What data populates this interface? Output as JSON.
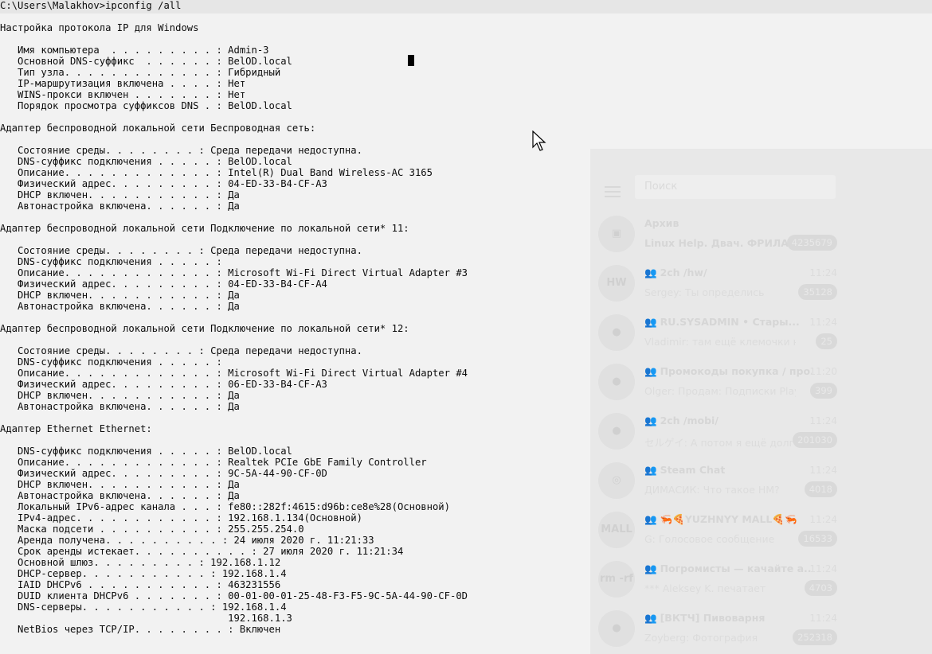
{
  "console": {
    "lines": [
      "C:\\Users\\Malakhov>ipconfig /all",
      "",
      "Настройка протокола IP для Windows",
      "",
      "   Имя компьютера  . . . . . . . . . : Admin-3",
      "   Основной DNS-суффикс  . . . . . . : BelOD.local",
      "   Тип узла. . . . . . . . . . . . . : Гибридный",
      "   IP-маршрутизация включена . . . . : Нет",
      "   WINS-прокси включен . . . . . . . : Нет",
      "   Порядок просмотра суффиксов DNS . : BelOD.local",
      "",
      "Адаптер беспроводной локальной сети Беспроводная сеть:",
      "",
      "   Состояние среды. . . . . . . . : Среда передачи недоступна.",
      "   DNS-суффикс подключения . . . . . : BelOD.local",
      "   Описание. . . . . . . . . . . . . : Intel(R) Dual Band Wireless-AC 3165",
      "   Физический адрес. . . . . . . . . : 04-ED-33-B4-CF-A3",
      "   DHCP включен. . . . . . . . . . . : Да",
      "   Автонастройка включена. . . . . . : Да",
      "",
      "Адаптер беспроводной локальной сети Подключение по локальной сети* 11:",
      "",
      "   Состояние среды. . . . . . . . : Среда передачи недоступна.",
      "   DNS-суффикс подключения . . . . . :",
      "   Описание. . . . . . . . . . . . . : Microsoft Wi-Fi Direct Virtual Adapter #3",
      "   Физический адрес. . . . . . . . . : 04-ED-33-B4-CF-A4",
      "   DHCP включен. . . . . . . . . . . : Да",
      "   Автонастройка включена. . . . . . : Да",
      "",
      "Адаптер беспроводной локальной сети Подключение по локальной сети* 12:",
      "",
      "   Состояние среды. . . . . . . . : Среда передачи недоступна.",
      "   DNS-суффикс подключения . . . . . :",
      "   Описание. . . . . . . . . . . . . : Microsoft Wi-Fi Direct Virtual Adapter #4",
      "   Физический адрес. . . . . . . . . : 06-ED-33-B4-CF-A3",
      "   DHCP включен. . . . . . . . . . . : Да",
      "   Автонастройка включена. . . . . . : Да",
      "",
      "Адаптер Ethernet Ethernet:",
      "",
      "   DNS-суффикс подключения . . . . . : BelOD.local",
      "   Описание. . . . . . . . . . . . . : Realtek PCIe GbE Family Controller",
      "   Физический адрес. . . . . . . . . : 9C-5A-44-90-CF-0D",
      "   DHCP включен. . . . . . . . . . . : Да",
      "   Автонастройка включена. . . . . . : Да",
      "   Локальный IPv6-адрес канала . . . : fe80::282f:4615:d96b:ce8e%28(Основной)",
      "   IPv4-адрес. . . . . . . . . . . . : 192.168.1.134(Основной)",
      "   Маска подсети . . . . . . . . . . : 255.255.254.0",
      "   Аренда получена. . . . . . . . . . : 24 июля 2020 г. 11:21:33",
      "   Срок аренды истекает. . . . . . . . . . : 27 июля 2020 г. 11:21:34",
      "   Основной шлюз. . . . . . . . . : 192.168.1.12",
      "   DHCP-сервер. . . . . . . . . . . : 192.168.1.4",
      "   IAID DHCPv6 . . . . . . . . . . . : 463231556",
      "   DUID клиента DHCPv6 . . . . . . . : 00-01-00-01-25-48-F3-F5-9C-5A-44-90-CF-0D",
      "   DNS-серверы. . . . . . . . . . . : 192.168.1.4",
      "                                       192.168.1.3",
      "   NetBios через TCP/IP. . . . . . . . : Включен"
    ]
  },
  "telegram": {
    "search_placeholder": "Поиск",
    "chats": [
      {
        "title": "Архив",
        "group": false,
        "time": "",
        "preview": "Linux Help. Двач. ФРИЛА...",
        "preview_bold": true,
        "badge": "4235679",
        "avatar": "▣"
      },
      {
        "title": "2ch /hw/",
        "group": true,
        "time": "11:24",
        "preview": "Sergey: Ты определись",
        "preview_bold": false,
        "badge": "35128",
        "avatar": "HW"
      },
      {
        "title": "RU.SYSADMIN • Стары...",
        "group": true,
        "time": "11:24",
        "preview": "Vladimir: там ещё клемочки нед...",
        "preview_bold": false,
        "badge": "25",
        "avatar": "●"
      },
      {
        "title": "Промокоды покупка / про...",
        "group": true,
        "time": "11:20",
        "preview": "Olger: Продам: Подписки PlaySta...",
        "preview_bold": false,
        "badge": "399",
        "avatar": "●"
      },
      {
        "title": "2ch /mobi/",
        "group": true,
        "time": "11:24",
        "preview": "セルゲイ: А потом я ещё долго...",
        "preview_bold": false,
        "badge": "201030",
        "avatar": "●"
      },
      {
        "title": "Steam Chat",
        "group": true,
        "time": "11:24",
        "preview": "ДИМАСИК: Что такое НМ?",
        "preview_bold": false,
        "badge": "4018",
        "avatar": "◎"
      },
      {
        "title": "🦐🍕YUZHNYY MALL🍕🦐",
        "group": true,
        "time": "11:24",
        "preview": "G: Голосовое сообщение",
        "preview_bold": false,
        "badge": "16533",
        "avatar": "MALL"
      },
      {
        "title": "Погромисты — качайте а...",
        "group": true,
        "time": "11:24",
        "preview": "*** Aleksey K. печатает",
        "preview_bold": false,
        "badge": "4703",
        "avatar": "rm -rf"
      },
      {
        "title": "[ВКТЧ] Пивоварня",
        "group": true,
        "time": "11:24",
        "preview": "Zoyberg: Фотография",
        "preview_bold": false,
        "badge": "252318",
        "avatar": "●"
      }
    ]
  }
}
